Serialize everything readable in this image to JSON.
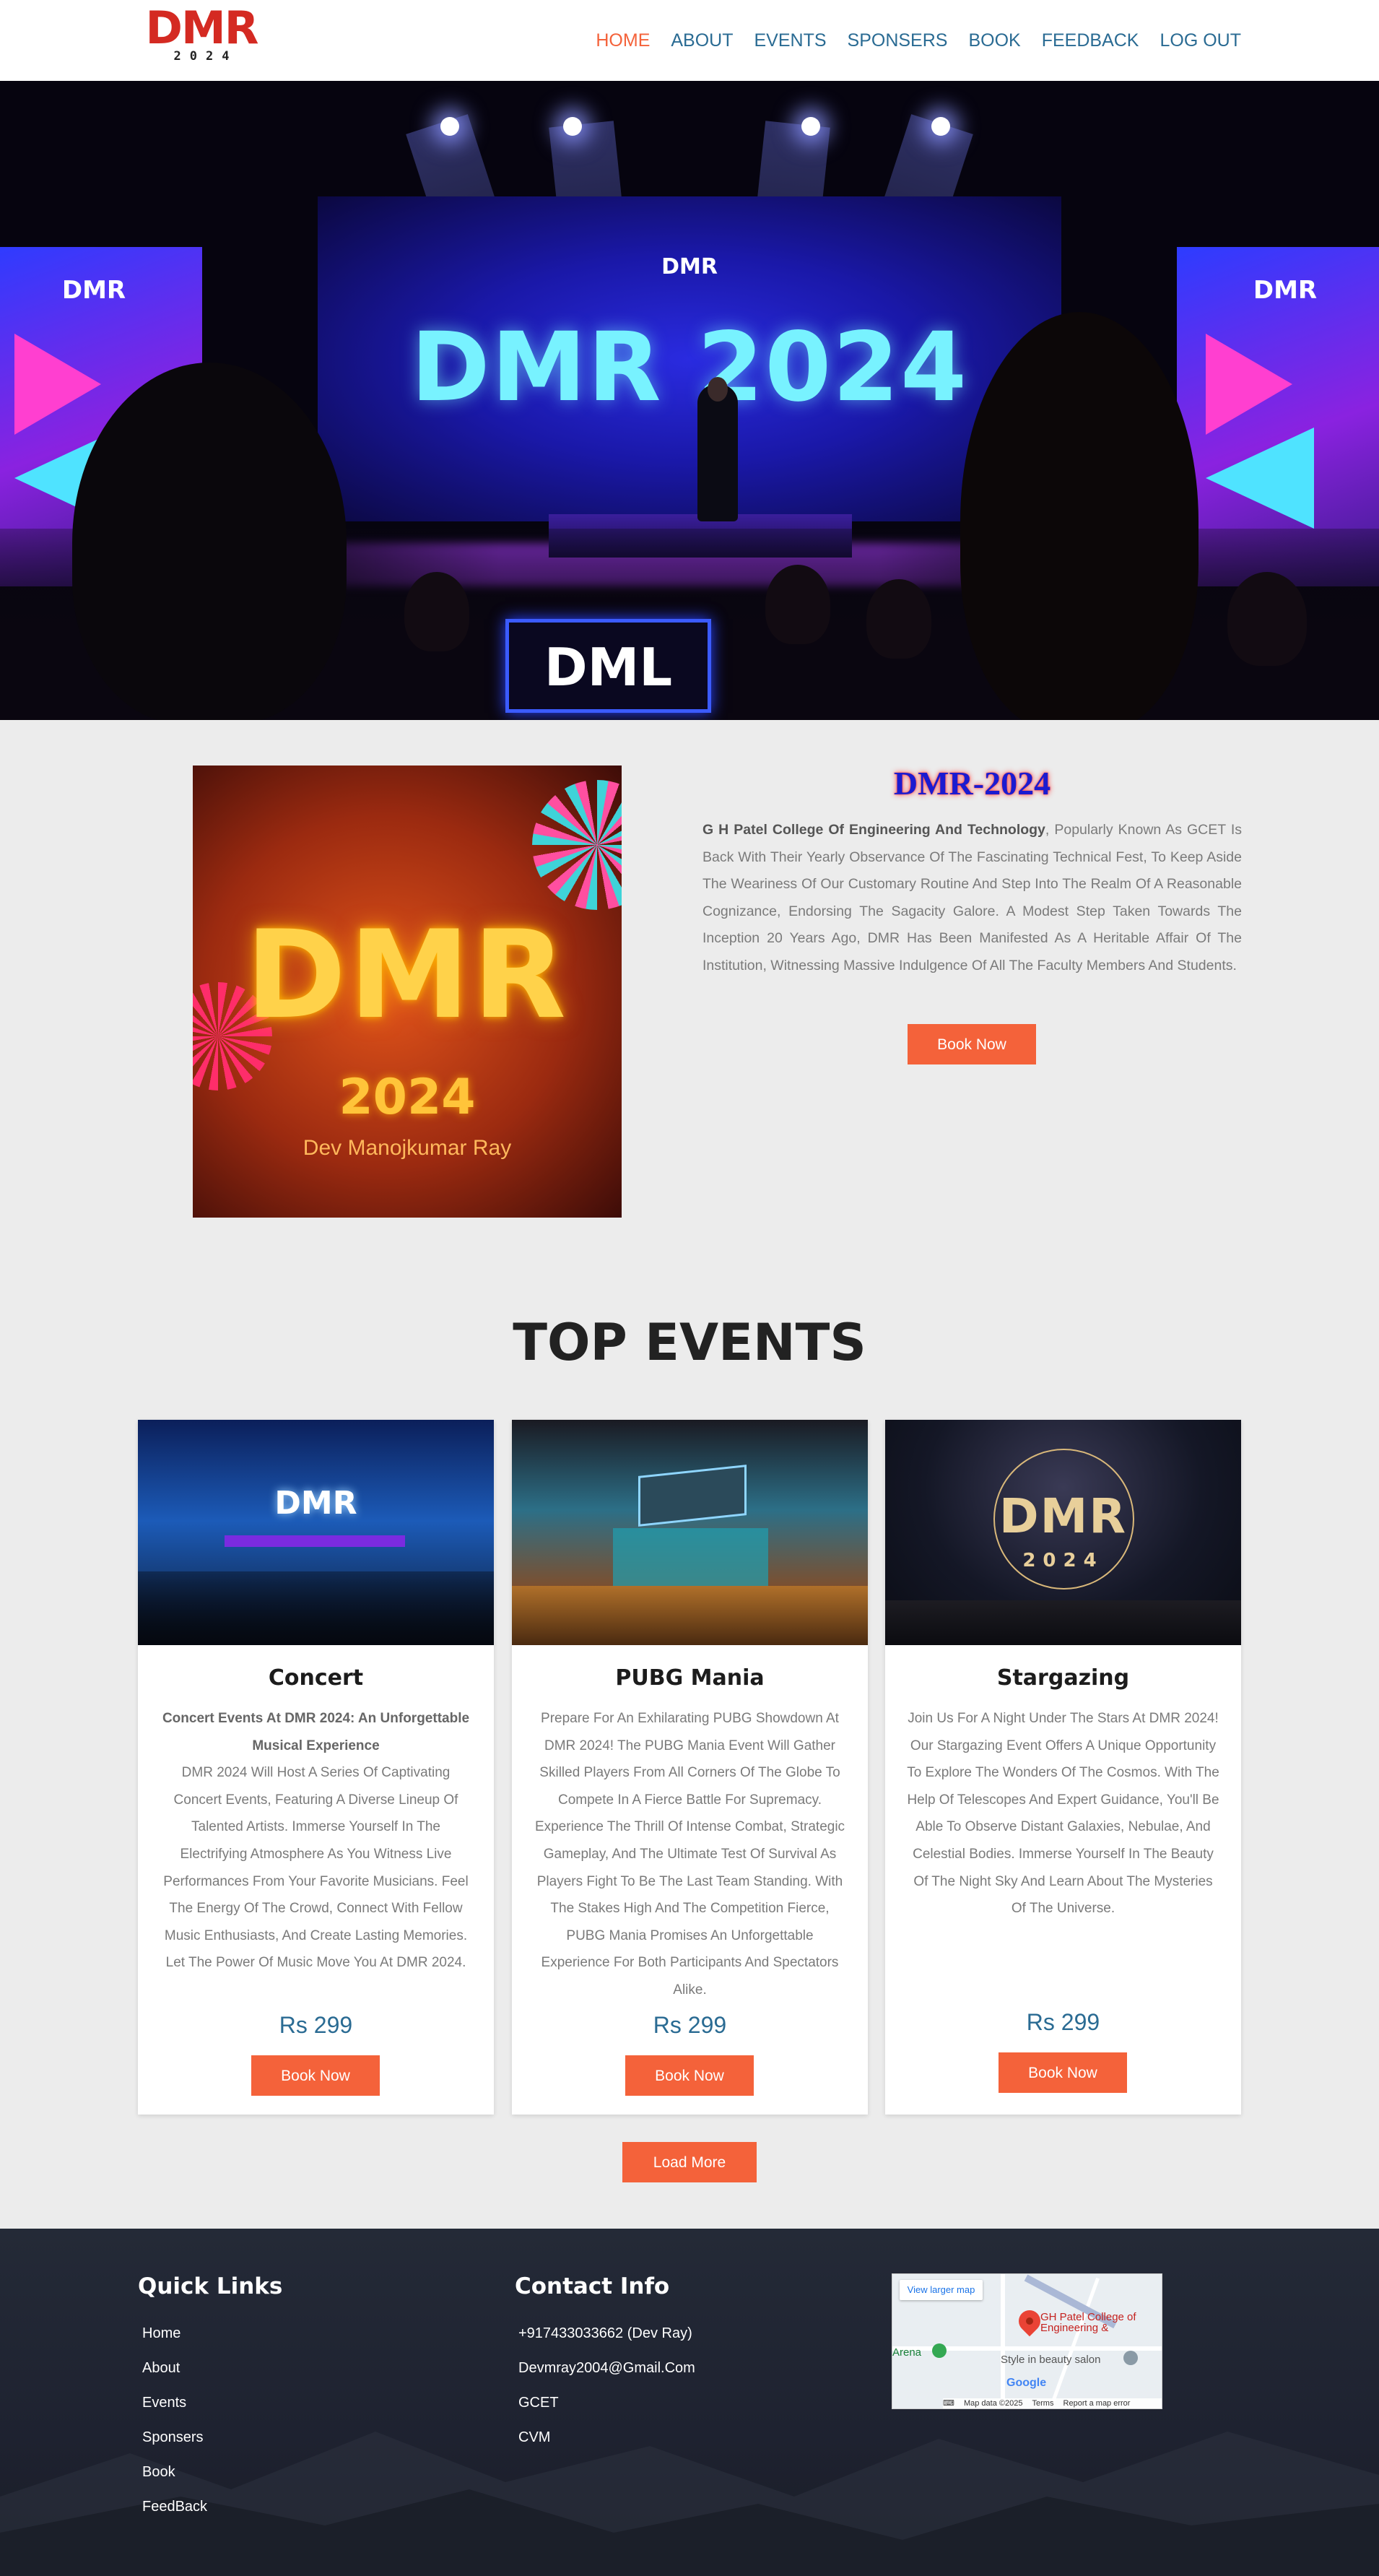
{
  "header": {
    "logo_text": "DMR",
    "logo_year": "2024",
    "nav": [
      {
        "label": "HOME",
        "active": true
      },
      {
        "label": "ABOUT"
      },
      {
        "label": "EVENTS"
      },
      {
        "label": "SPONSERS"
      },
      {
        "label": "BOOK"
      },
      {
        "label": "FEEDBACK"
      },
      {
        "label": "LOG OUT"
      }
    ]
  },
  "hero": {
    "stage_title": "DMR 2024",
    "stage_small_logo": "DMR",
    "side_logo": "DMR",
    "podium_logo": "DML"
  },
  "about": {
    "poster_title": "DMR",
    "poster_year": "2024",
    "poster_name": "Dev Manojkumar Ray",
    "title": "DMR-2024",
    "text_bold": "G H Patel College Of Engineering And Technology",
    "text_rest": ", Popularly Known As GCET Is Back With Their Yearly Observance Of The Fascinating Technical Fest, To Keep Aside The Weariness Of Our Customary Routine And Step Into The Realm Of A Reasonable Cognizance, Endorsing The Sagacity Galore. A Modest Step Taken Towards The Inception 20 Years Ago, DMR Has Been Manifested As A Heritable Affair Of The Institution, Witnessing Massive Indulgence Of All The Faculty Members And Students.",
    "button": "Book Now"
  },
  "events": {
    "title": "TOP EVENTS",
    "cards": [
      {
        "image_text": "DMR",
        "title": "Concert",
        "subtitle": "Concert Events At DMR 2024: An Unforgettable Musical Experience",
        "description": "DMR 2024 Will Host A Series Of Captivating Concert Events, Featuring A Diverse Lineup Of Talented Artists. Immerse Yourself In The Electrifying Atmosphere As You Witness Live Performances From Your Favorite Musicians. Feel The Energy Of The Crowd, Connect With Fellow Music Enthusiasts, And Create Lasting Memories. Let The Power Of Music Move You At DMR 2024.",
        "price": "Rs 299",
        "button": "Book Now"
      },
      {
        "title": "PUBG Mania",
        "subtitle": "",
        "description": "Prepare For An Exhilarating PUBG Showdown At DMR 2024! The PUBG Mania Event Will Gather Skilled Players From All Corners Of The Globe To Compete In A Fierce Battle For Supremacy. Experience The Thrill Of Intense Combat, Strategic Gameplay, And The Ultimate Test Of Survival As Players Fight To Be The Last Team Standing. With The Stakes High And The Competition Fierce, PUBG Mania Promises An Unforgettable Experience For Both Participants And Spectators Alike.",
        "price": "Rs 299",
        "button": "Book Now"
      },
      {
        "image_text": "DMR",
        "image_year": "2024",
        "title": "Stargazing",
        "subtitle": "",
        "description": "Join Us For A Night Under The Stars At DMR 2024! Our Stargazing Event Offers A Unique Opportunity To Explore The Wonders Of The Cosmos. With The Help Of Telescopes And Expert Guidance, You'll Be Able To Observe Distant Galaxies, Nebulae, And Celestial Bodies. Immerse Yourself In The Beauty Of The Night Sky And Learn About The Mysteries Of The Universe.",
        "price": "Rs 299",
        "button": "Book Now"
      }
    ],
    "load_more": "Load More"
  },
  "footer": {
    "quick_links_title": "Quick Links",
    "quick_links": [
      "Home",
      "About",
      "Events",
      "Sponsers",
      "Book",
      "FeedBack"
    ],
    "contact_title": "Contact Info",
    "contact": [
      "+917433033662 (Dev Ray)",
      "Devmray2004@Gmail.Com",
      "GCET",
      "CVM"
    ],
    "map": {
      "larger_map": "View larger map",
      "place": "GH Patel College of Engineering &",
      "arena": "Arena",
      "salon": "Style in beauty salon",
      "google": "Google",
      "attribution": [
        "Map data ©2025",
        "Terms",
        "Report a map error"
      ]
    }
  }
}
